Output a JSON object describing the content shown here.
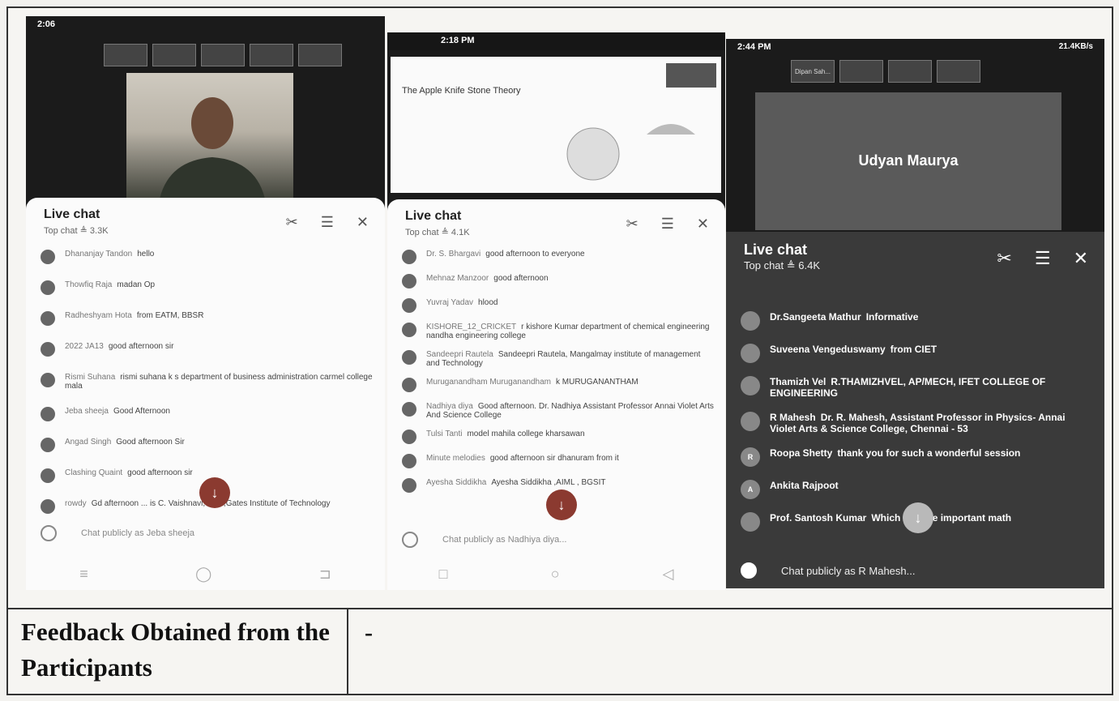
{
  "phone1": {
    "status_time": "2:06",
    "chat_title": "Live chat",
    "chat_sub": "Top chat  ≜ 3.3K",
    "messages": [
      {
        "author": "Dhananjay Tandon",
        "text": "hello"
      },
      {
        "author": "Thowfiq Raja",
        "text": "madan Op"
      },
      {
        "author": "Radheshyam Hota",
        "text": "from EATM, BBSR"
      },
      {
        "author": "2022 JA13",
        "text": "good afternoon sir"
      },
      {
        "author": "Rismi Suhana",
        "text": "rismi suhana k s department of business administration carmel college mala"
      },
      {
        "author": "Jeba sheeja",
        "text": "Good Afternoon"
      },
      {
        "author": "Angad Singh",
        "text": "Good afternoon Sir"
      },
      {
        "author": "Clashing Quaint",
        "text": "good afternoon sir"
      },
      {
        "author": "rowdy",
        "text": "Gd afternoon ... is C. Vaishnavi, EEE,Gates Institute of Technology"
      }
    ],
    "input_placeholder": "Chat publicly as Jeba sheeja"
  },
  "phone2": {
    "status_time": "2:18 PM",
    "slide_title": "The Apple Knife Stone Theory",
    "chat_title": "Live chat",
    "chat_sub": "Top chat  ≜ 4.1K",
    "messages": [
      {
        "author": "Dr. S. Bhargavi",
        "text": "good afternoon to everyone"
      },
      {
        "author": "Mehnaz Manzoor",
        "text": "good afternoon"
      },
      {
        "author": "Yuvraj Yadav",
        "text": "hlood"
      },
      {
        "author": "KISHORE_12_CRICKET",
        "text": "r kishore Kumar department of chemical engineering nandha engineering college"
      },
      {
        "author": "Sandeepri Rautela",
        "text": "Sandeepri Rautela, Mangalmay institute of management and Technology"
      },
      {
        "author": "Muruganandham Muruganandham",
        "text": "k MURUGANANTHAM"
      },
      {
        "author": "Nadhiya diya",
        "text": "Good afternoon. Dr. Nadhiya Assistant Professor Annai Violet Arts And Science College"
      },
      {
        "author": "Tulsi Tanti",
        "text": "model mahila college kharsawan"
      },
      {
        "author": "Minute melodies",
        "text": "good afternoon sir dhanuram from it"
      },
      {
        "author": "Ayesha Siddikha",
        "text": "Ayesha Siddikha ,AIML , BGSIT"
      }
    ],
    "input_placeholder": "Chat publicly as Nadhiya diya..."
  },
  "phone3": {
    "status_time": "2:44 PM",
    "status_right": "21.4KB/s",
    "thumb_label": "Dipan Sah...",
    "speaker_name": "Udyan Maurya",
    "chat_title": "Live chat",
    "chat_sub": "Top chat  ≜ 6.4K",
    "messages": [
      {
        "author": "Dr.Sangeeta Mathur",
        "text": "Informative",
        "initial": ""
      },
      {
        "author": "Suveena Vengeduswamy",
        "text": "from CIET",
        "initial": ""
      },
      {
        "author": "Thamizh Vel",
        "text": "R.THAMIZHVEL, AP/MECH, IFET COLLEGE OF ENGINEERING",
        "initial": ""
      },
      {
        "author": "R Mahesh",
        "text": "Dr. R. Mahesh, Assistant Professor in Physics- Annai Violet Arts & Science College, Chennai - 53",
        "initial": ""
      },
      {
        "author": "Roopa Shetty",
        "text": "thank you for such a wonderful session",
        "initial": "R"
      },
      {
        "author": "Ankita Rajpoot",
        "text": "",
        "initial": "A"
      },
      {
        "author": "Prof. Santosh Kumar",
        "text": "Which is more important math",
        "initial": ""
      }
    ],
    "input_placeholder": "Chat publicly as R Mahesh..."
  },
  "feedback": {
    "label": "Feedback Obtained from the Participants",
    "value": "-"
  }
}
